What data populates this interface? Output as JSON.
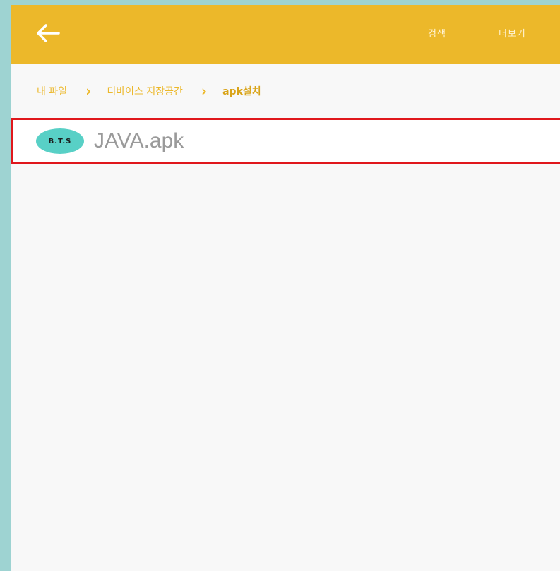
{
  "toolbar": {
    "back_icon": "arrow-left-icon",
    "search_label": "검색",
    "more_label": "더보기",
    "bg_color": "#ecb82a"
  },
  "breadcrumb": {
    "items": [
      "내 파일",
      "디바이스 저장공간",
      "apk설치"
    ],
    "separator_icon": "chevron-right-icon"
  },
  "files": [
    {
      "name": "JAVA.apk",
      "icon_text": "B.T.S",
      "icon_color": "#58d0c6",
      "highlighted": true,
      "highlight_color": "#e0171c"
    }
  ]
}
